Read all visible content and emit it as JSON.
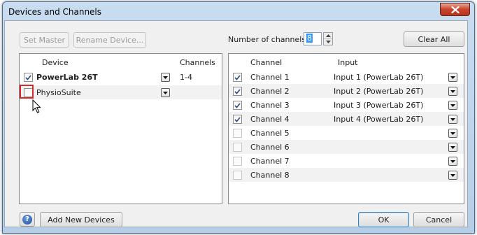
{
  "window": {
    "title": "Devices and Channels"
  },
  "toolbar": {
    "set_master_label": "Set Master",
    "rename_device_label": "Rename Device...",
    "num_channels_label": "Number of channels:",
    "num_channels_value": "8",
    "clear_all_label": "Clear All"
  },
  "devices": {
    "headers": {
      "device": "Device",
      "channels": "Channels"
    },
    "rows": [
      {
        "name": "PowerLab 26T",
        "channels": "1-4",
        "checked": true,
        "bold": true
      },
      {
        "name": "PhysioSuite",
        "channels": "",
        "checked": false,
        "bold": false
      }
    ]
  },
  "channels": {
    "headers": {
      "channel": "Channel",
      "input": "Input"
    },
    "rows": [
      {
        "channel": "Channel 1",
        "input": "Input 1 (PowerLab 26T)",
        "checked": true
      },
      {
        "channel": "Channel 2",
        "input": "Input 2 (PowerLab 26T)",
        "checked": true
      },
      {
        "channel": "Channel 3",
        "input": "Input 3 (PowerLab 26T)",
        "checked": true
      },
      {
        "channel": "Channel 4",
        "input": "Input 4 (PowerLab 26T)",
        "checked": true
      },
      {
        "channel": "Channel 5",
        "input": "",
        "checked": false
      },
      {
        "channel": "Channel 6",
        "input": "",
        "checked": false
      },
      {
        "channel": "Channel 7",
        "input": "",
        "checked": false
      },
      {
        "channel": "Channel 8",
        "input": "",
        "checked": false
      }
    ]
  },
  "footer": {
    "help_symbol": "?",
    "add_devices_label": "Add New Devices",
    "ok_label": "OK",
    "cancel_label": "Cancel"
  },
  "icons": {
    "close": "close-icon",
    "help": "help-icon",
    "dropdown": "chevron-down-icon",
    "checkbox": "checkmark-icon",
    "cursor": "mouse-pointer-icon"
  }
}
